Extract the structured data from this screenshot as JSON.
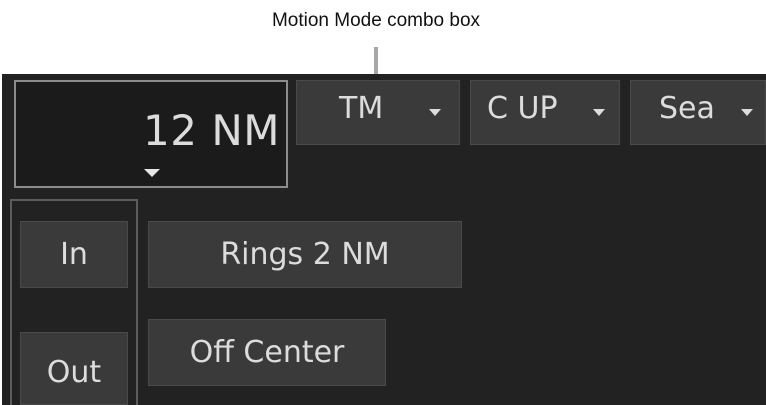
{
  "callout": {
    "label": "Motion Mode combo box"
  },
  "range": {
    "value": "12 NM",
    "dropdown_icon": "caret-down-icon"
  },
  "combos": {
    "motion_mode": {
      "label": "TM",
      "icon": "caret-down-icon"
    },
    "orientation": {
      "label": "C UP",
      "icon": "caret-down-icon"
    },
    "stabilization": {
      "label": "Sea",
      "icon": "caret-down-icon"
    }
  },
  "buttons": {
    "zoom_in": "In",
    "zoom_out": "Out",
    "rings": "Rings 2 NM",
    "off_center": "Off Center"
  },
  "colors": {
    "panel_background": "#222222",
    "button_background": "#3a3a3a",
    "text": "#dcdcdc",
    "frame_border": "#8c8c8c"
  }
}
